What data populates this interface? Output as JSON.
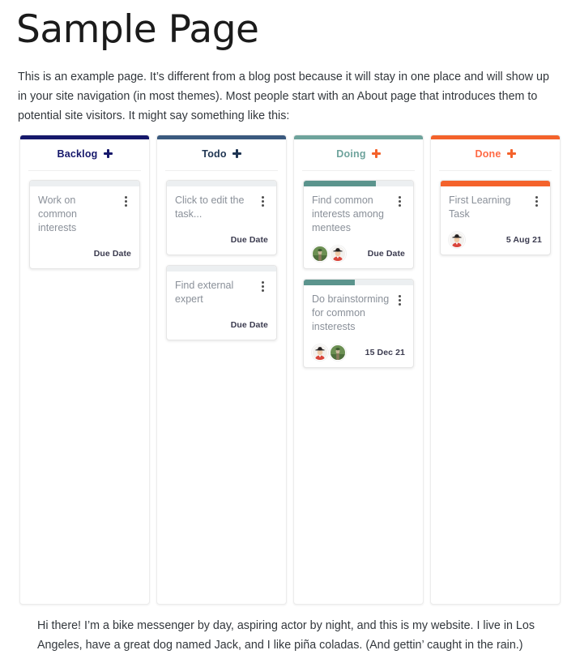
{
  "page": {
    "title": "Sample Page",
    "intro": "This is an example page. It’s different from a blog post because it will stay in one place and will show up in your site navigation (in most themes). Most people start with an About page that introduces them to potential site visitors. It might say something like this:",
    "outro": "Hi there! I’m a bike messenger by day, aspiring actor by night, and this is my website. I live in Los Angeles, have a great dog named Jack, and I like piña coladas. (And gettin’ caught in the rain.)"
  },
  "board": {
    "add_icon": "plus-icon",
    "menu_icon": "kebab-menu-icon",
    "columns": [
      {
        "id": "backlog",
        "title": "Backlog",
        "accent": "#16186b",
        "title_color": "#16186b",
        "add_color": "#16186b",
        "cards": [
          {
            "title": "Work on common interests",
            "progress": 0,
            "progress_color": "#eceff1",
            "due": "Due Date",
            "avatars": []
          }
        ]
      },
      {
        "id": "todo",
        "title": "Todo",
        "accent": "#3b5a7f",
        "title_color": "#1f3552",
        "add_color": "#1f3552",
        "cards": [
          {
            "title": "Click to edit the task...",
            "progress": 0,
            "progress_color": "#eceff1",
            "due": "Due Date",
            "avatars": []
          },
          {
            "title": "Find external expert",
            "progress": 0,
            "progress_color": "#eceff1",
            "due": "Due Date",
            "avatars": []
          }
        ]
      },
      {
        "id": "doing",
        "title": "Doing",
        "accent": "#6ea39c",
        "title_color": "#6ea39c",
        "add_color": "#f4622b",
        "cards": [
          {
            "title": "Find common interests among mentees",
            "progress": 66,
            "progress_color": "#5b948d",
            "due": "Due Date",
            "avatars": [
              "avatar-green-person",
              "avatar-dark-hat-person"
            ]
          },
          {
            "title": "Do brainstorming for common insterests",
            "progress": 47,
            "progress_color": "#5b948d",
            "due": "15 Dec 21",
            "avatars": [
              "avatar-dark-hat-person",
              "avatar-green-person"
            ]
          }
        ]
      },
      {
        "id": "done",
        "title": "Done",
        "accent": "#f4622b",
        "title_color": "#ff6a45",
        "add_color": "#f4622b",
        "cards": [
          {
            "title": "First Learning Task",
            "progress": 100,
            "progress_color": "#f4622b",
            "due": "5 Aug 21",
            "avatars": [
              "avatar-dark-hat-person"
            ]
          }
        ]
      }
    ]
  }
}
